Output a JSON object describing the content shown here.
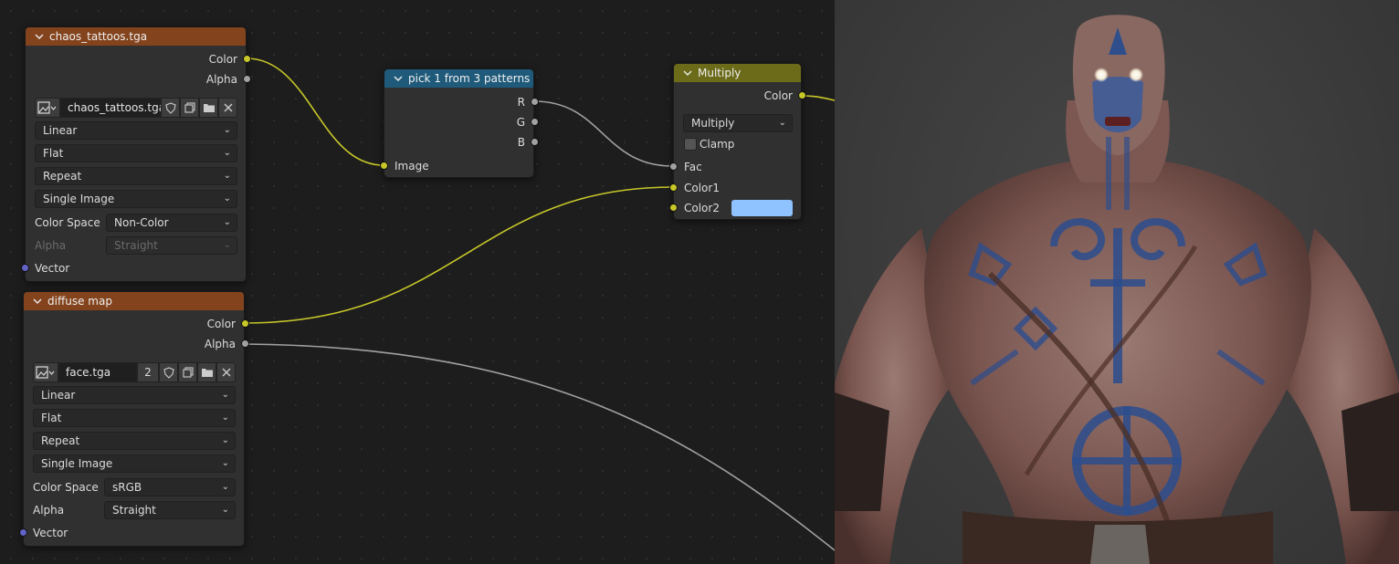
{
  "colors": {
    "image_header": "#83431c",
    "group_header": "#1f5a7a",
    "mix_header": "#6b6b1a",
    "socket_color": "#c7c729",
    "socket_gray": "#a1a1a1",
    "socket_vector": "#6363c7",
    "color2_swatch": "#8fc3ff"
  },
  "node_tattoos": {
    "title": "chaos_tattoos.tga",
    "out_color": "Color",
    "out_alpha": "Alpha",
    "image_name": "chaos_tattoos.tga",
    "interpolation": "Linear",
    "projection": "Flat",
    "extension": "Repeat",
    "source": "Single Image",
    "color_space_label": "Color Space",
    "color_space": "Non-Color",
    "alpha_label": "Alpha",
    "alpha_mode": "Straight",
    "in_vector": "Vector"
  },
  "node_diffuse": {
    "title": "diffuse map",
    "out_color": "Color",
    "out_alpha": "Alpha",
    "image_name": "face.tga",
    "users": "2",
    "interpolation": "Linear",
    "projection": "Flat",
    "extension": "Repeat",
    "source": "Single Image",
    "color_space_label": "Color Space",
    "color_space": "sRGB",
    "alpha_label": "Alpha",
    "alpha_mode": "Straight",
    "in_vector": "Vector"
  },
  "node_group": {
    "title": "pick 1 from 3 patterns",
    "out_r": "R",
    "out_g": "G",
    "out_b": "B",
    "in_image": "Image"
  },
  "node_multiply": {
    "title": "Multiply",
    "out_color": "Color",
    "blend_mode": "Multiply",
    "clamp_label": "Clamp",
    "clamp_checked": false,
    "in_fac": "Fac",
    "in_color1": "Color1",
    "in_color2": "Color2"
  },
  "viewport": {
    "icon": "character-render-icon"
  }
}
